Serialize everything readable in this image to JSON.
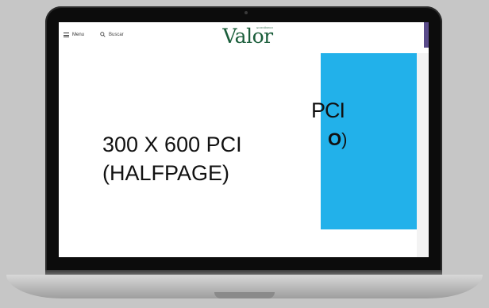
{
  "topbar": {
    "menu_label": "Menu",
    "search_label": "Buscar",
    "logo_small": "ECONÔMICO",
    "logo_main": "Valor"
  },
  "ad_placeholder": {
    "line1": "300 X 600 PCI",
    "line2": "(HALFPAGE)",
    "pci_label": "PCI",
    "o_letter": "O",
    "o_paren": ")"
  },
  "colors": {
    "banner": "#22b1ea",
    "logo": "#1b5e3b",
    "accent_tab": "#5a4b8a"
  }
}
